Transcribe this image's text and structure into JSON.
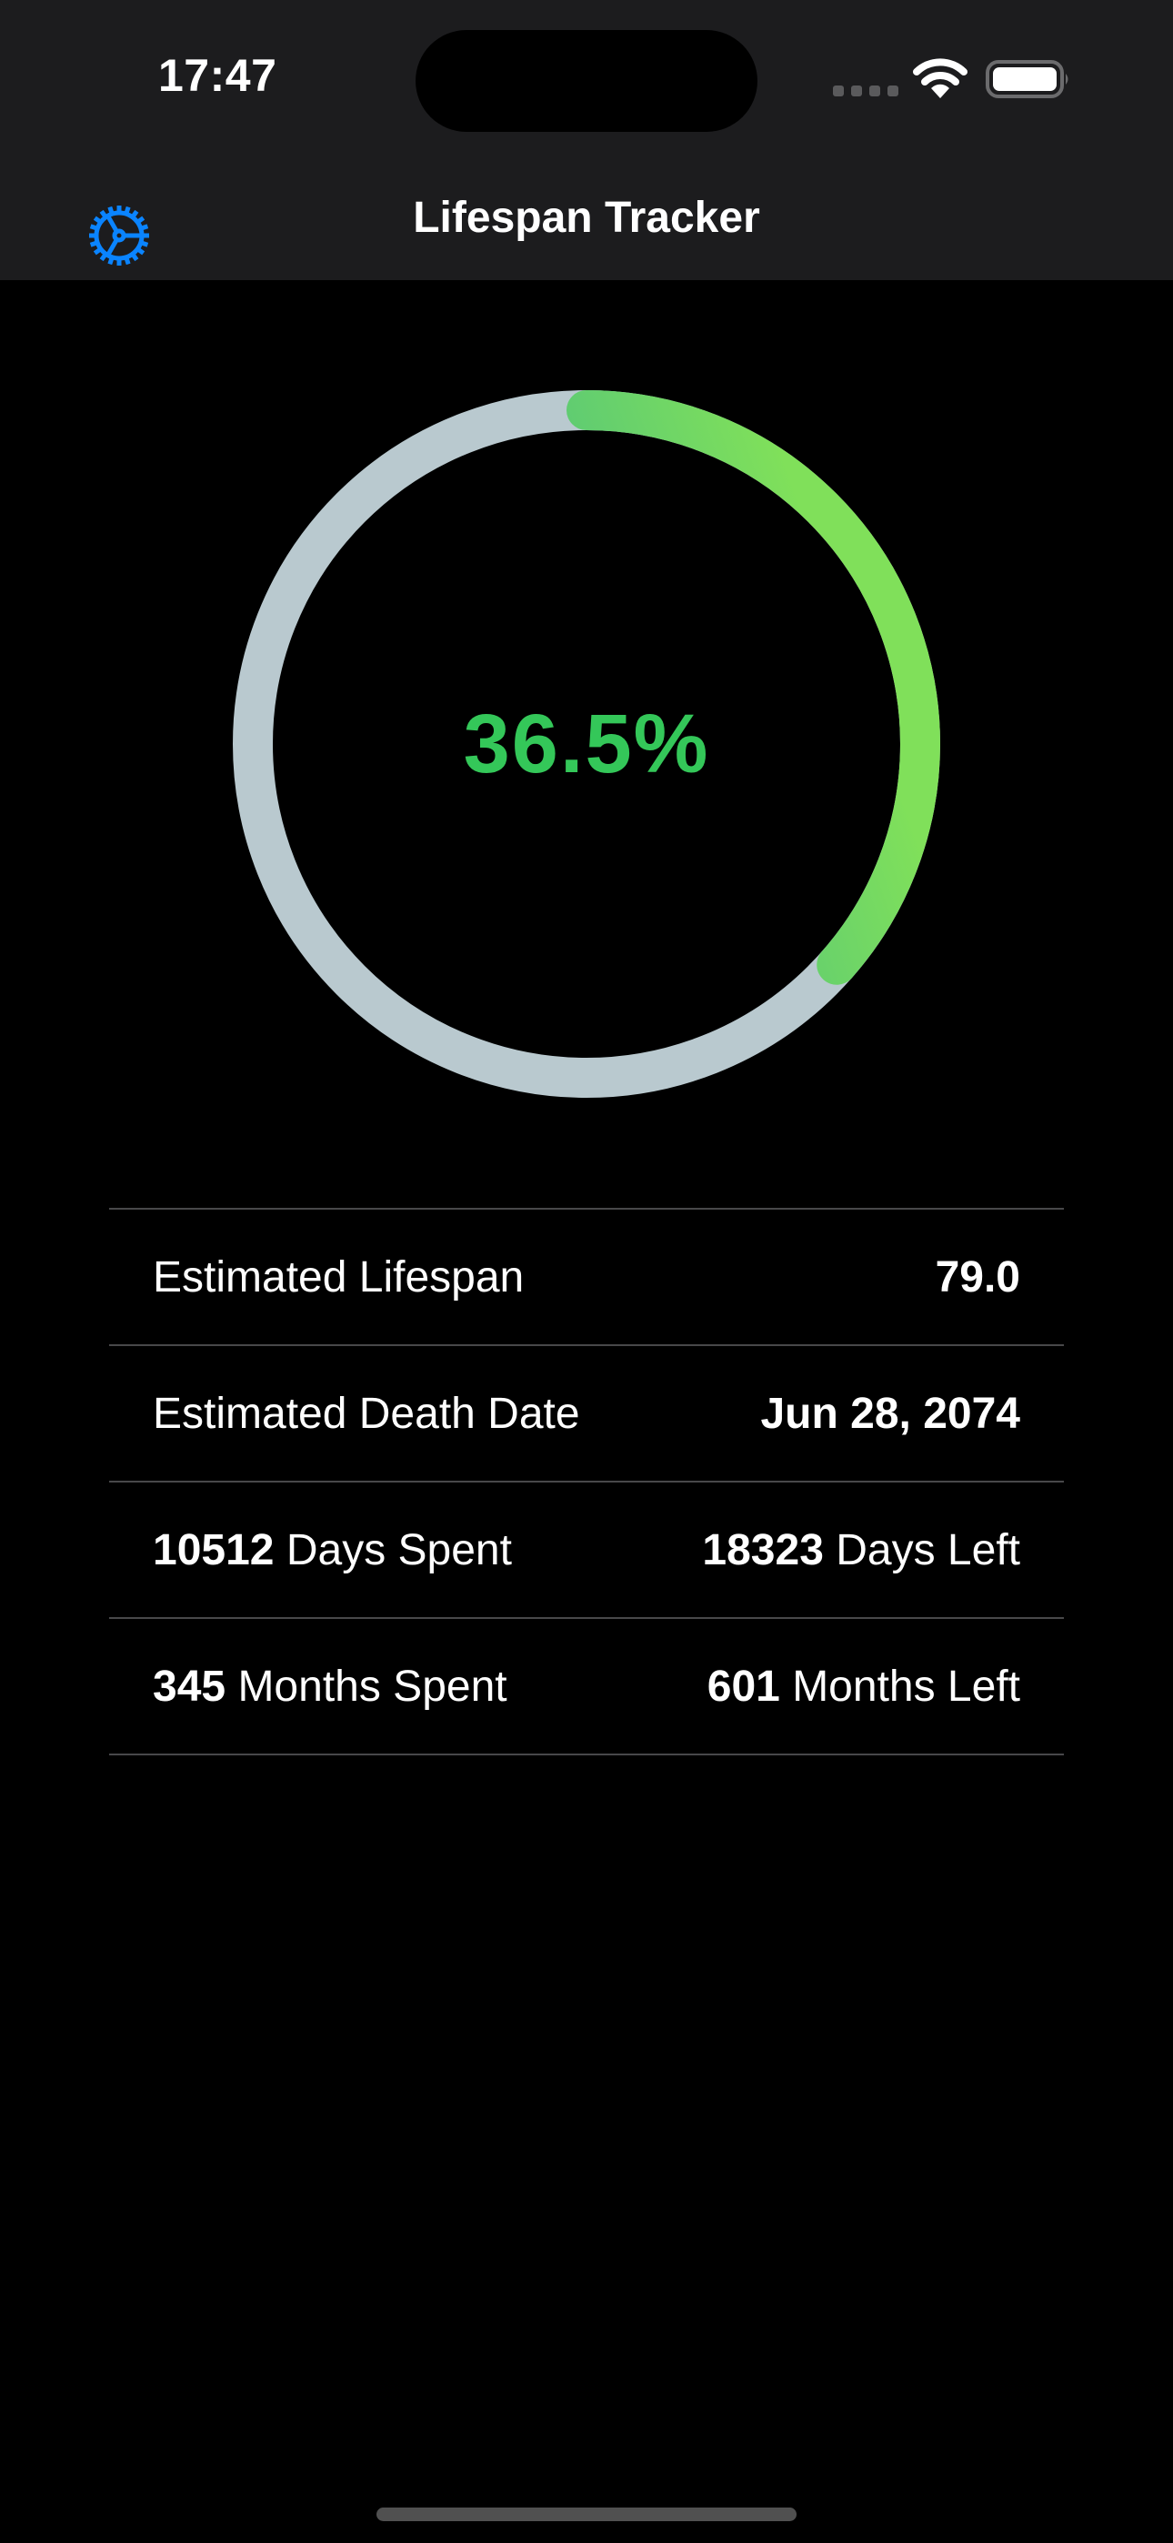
{
  "status_bar": {
    "time": "17:47",
    "wifi_icon": "wifi-icon",
    "battery_icon": "battery-full-icon",
    "signal_icon": "signal-dots-icon"
  },
  "nav": {
    "title": "Lifespan Tracker",
    "settings_icon": "gear-icon"
  },
  "colors": {
    "accent": "#0a84ff",
    "percent_text": "#34c759",
    "track": "#b9c9cf",
    "gradient_start": "#0a97b0",
    "gradient_end": "#80e05a"
  },
  "progress": {
    "fraction": 0.365,
    "label": "36.5%"
  },
  "stats": {
    "lifespan": {
      "label": "Estimated Lifespan",
      "value": "79.0"
    },
    "death_date": {
      "label": "Estimated Death Date",
      "value": "Jun 28, 2074"
    },
    "days": {
      "spent_value": "10512",
      "spent_label": "Days Spent",
      "left_value": "18323",
      "left_label": "Days Left"
    },
    "months": {
      "spent_value": "345",
      "spent_label": "Months Spent",
      "left_value": "601",
      "left_label": "Months Left"
    }
  }
}
